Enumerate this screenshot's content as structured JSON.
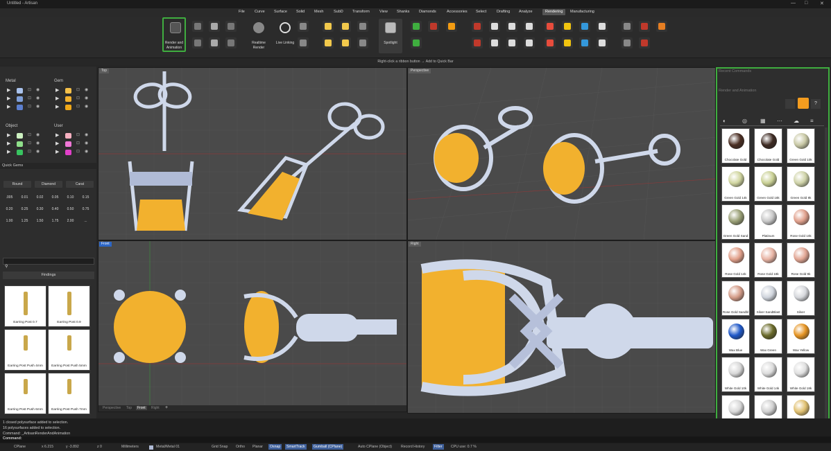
{
  "window": {
    "title": "Untitled - Artisan"
  },
  "menu": [
    "File",
    "Curve",
    "Surface",
    "Solid",
    "Mesh",
    "SubD",
    "Transform",
    "View",
    "Shanks",
    "Diamonds",
    "Accessories",
    "Select",
    "Drafting",
    "Analyze",
    "Rendering",
    "Manufacturing"
  ],
  "menu_active": "Rendering",
  "ribbon": {
    "render_anim": "Render and Animation",
    "realtime": "Realtime Render",
    "live": "Live Linking",
    "spotlight": "Spotlight",
    "hint": "Right-click a ribbon button → Add to Quick Bar"
  },
  "left": {
    "metal": "Metal",
    "gem": "Gem",
    "object": "Object",
    "user": "User",
    "quick_gems": "Quick Gems",
    "shapes": [
      "Round",
      "Diamond",
      "Carat"
    ],
    "sizes": [
      [
        ".005",
        "0.01",
        "0.02",
        "0.05",
        "0.10",
        "0.15"
      ],
      [
        "0.20",
        "0.25",
        "0.30",
        "0.40",
        "0.50",
        "0.75"
      ],
      [
        "1.00",
        "1.25",
        "1.50",
        "1.75",
        "2.00",
        "..."
      ]
    ],
    "findings": "Findings",
    "items": [
      "Earring Post 0.7",
      "Earring Post 0.9",
      "Earring Post Push 4mm",
      "Earring Post Push 5mm",
      "Earring Post Push 6mm",
      "Earring Post Push 7mm"
    ]
  },
  "viewports": {
    "top": "Top",
    "persp": "Perspective",
    "front": "Front",
    "right": "Right"
  },
  "vp_tabs": [
    "Perspective",
    "Top",
    "Front",
    "Right"
  ],
  "right": {
    "recent": "Recent Commands",
    "render": "Render and Animation",
    "materials": [
      {
        "name": "Chocolate Gold",
        "c": "#4a2e22"
      },
      {
        "name": "Chocolate Gold",
        "c": "#3d2a22"
      },
      {
        "name": "Green Gold 10k",
        "c": "#c9c9a6"
      },
      {
        "name": "Green Gold 14k",
        "c": "#d1d6a0"
      },
      {
        "name": "Green Gold 18k",
        "c": "#c9d094"
      },
      {
        "name": "Green Gold 9k",
        "c": "#cfd3a8"
      },
      {
        "name": "Green Gold Sand",
        "c": "#9aa076"
      },
      {
        "name": "Platinum",
        "c": "#c8c8c8"
      },
      {
        "name": "Rose Gold 10k",
        "c": "#e0a08c"
      },
      {
        "name": "Rose Gold 14k",
        "c": "#e2a08a"
      },
      {
        "name": "Rose Gold 18k",
        "c": "#e8b4a4"
      },
      {
        "name": "Rose Gold 9k",
        "c": "#e2a694"
      },
      {
        "name": "Rose Gold Sandbl",
        "c": "#d49c88"
      },
      {
        "name": "Silver SandBlast",
        "c": "#cfd4dc"
      },
      {
        "name": "Silver",
        "c": "#d6d8dc"
      },
      {
        "name": "Wax Blue",
        "c": "#1f58c8"
      },
      {
        "name": "Wax Green",
        "c": "#6a6a2a"
      },
      {
        "name": "Wax Yellow",
        "c": "#e59422"
      },
      {
        "name": "White Gold 10k",
        "c": "#d8d8d8"
      },
      {
        "name": "White Gold 14k",
        "c": "#dcdcdc"
      },
      {
        "name": "White Gold 18k",
        "c": "#e0e0e0"
      },
      {
        "name": "",
        "c": "#d8d8d8"
      },
      {
        "name": "",
        "c": "#d0d0d0"
      },
      {
        "name": "",
        "c": "#e0c070"
      }
    ]
  },
  "cmd": {
    "l1": "1 closed polysurface added to selection.",
    "l2": "16 polysurfaces added to selection.",
    "l3": "Command: _ArtisanRenderAndAnimation",
    "prompt": "Command:"
  },
  "status": {
    "cplane": "CPlane",
    "x": "x 6.215",
    "y": "y -3.892",
    "z": "z 0",
    "units": "Millimeters",
    "layer": "Metal/Metal 01",
    "grid": "Grid Snap",
    "ortho": "Ortho",
    "planar": "Planar",
    "osnap": "Osnap",
    "smart": "SmartTrack",
    "gumball": "Gumball (CPlane)",
    "auto": "Auto CPlane (Object)",
    "record": "Record History",
    "filter": "Filter",
    "cpu": "CPU use: 0.7 %"
  }
}
